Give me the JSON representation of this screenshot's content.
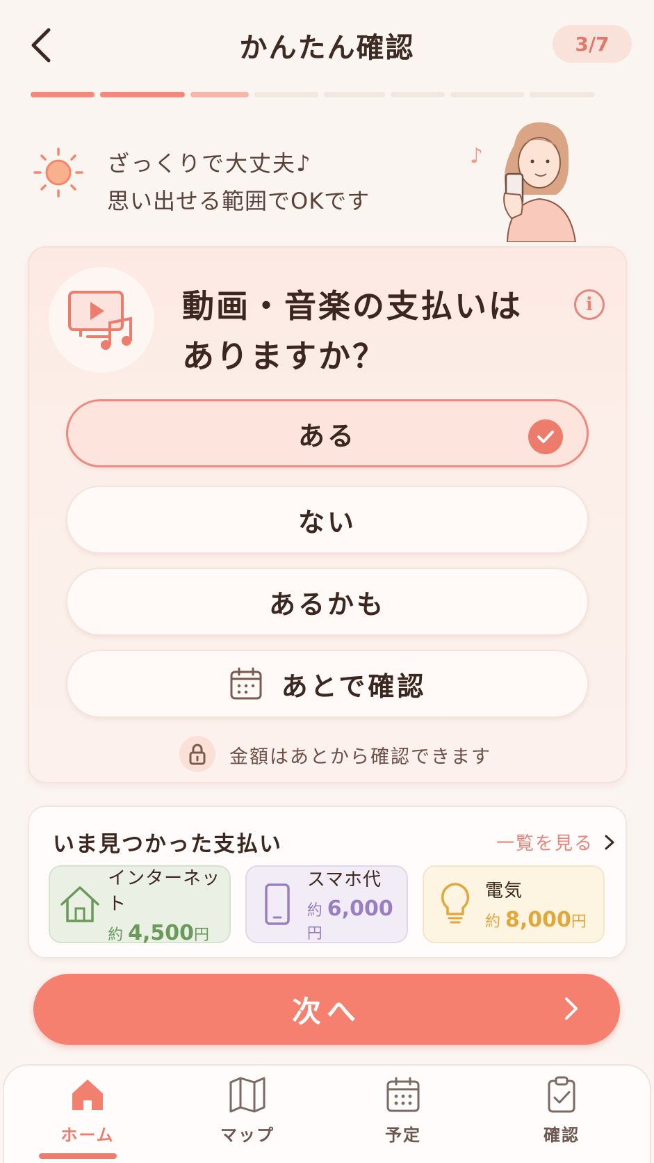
{
  "header": {
    "title": "かんたん確認",
    "step": "3/7"
  },
  "progress": {
    "total_steps": 8,
    "completed": 2,
    "current": 3
  },
  "hint": {
    "line1": "ざっくりで大丈夫♪",
    "line2": "思い出せる範囲でOKです"
  },
  "question": {
    "text_line1": "動画・音楽の支払いは",
    "text_line2": "ありますか？",
    "options": [
      {
        "label": "ある",
        "selected": true
      },
      {
        "label": "ない",
        "selected": false
      },
      {
        "label": "あるかも",
        "selected": false
      },
      {
        "label": "あとで確認",
        "selected": false
      }
    ],
    "note": "金額はあとから確認できます"
  },
  "found": {
    "title": "いま見つかった支払い",
    "see_all": "一覧を見る",
    "items": [
      {
        "name": "インターネット",
        "prefix": "約",
        "amount": "4,500",
        "unit": "円",
        "color": "#6a9a5a",
        "icon": "house-icon"
      },
      {
        "name": "スマホ代",
        "prefix": "約",
        "amount": "6,000",
        "unit": "円",
        "color": "#9a7fc0",
        "icon": "smartphone-icon"
      },
      {
        "name": "電気",
        "prefix": "約",
        "amount": "8,000",
        "unit": "円",
        "color": "#e3a63a",
        "icon": "lightbulb-icon"
      }
    ]
  },
  "next_button": "次へ",
  "nav": [
    {
      "label": "ホーム",
      "icon": "home-icon",
      "active": true
    },
    {
      "label": "マップ",
      "icon": "map-icon",
      "active": false
    },
    {
      "label": "予定",
      "icon": "calendar-icon",
      "active": false
    },
    {
      "label": "確認",
      "icon": "clipboard-check-icon",
      "active": false
    }
  ],
  "colors": {
    "accent": "#f6806f",
    "background": "#fbf5f2"
  }
}
